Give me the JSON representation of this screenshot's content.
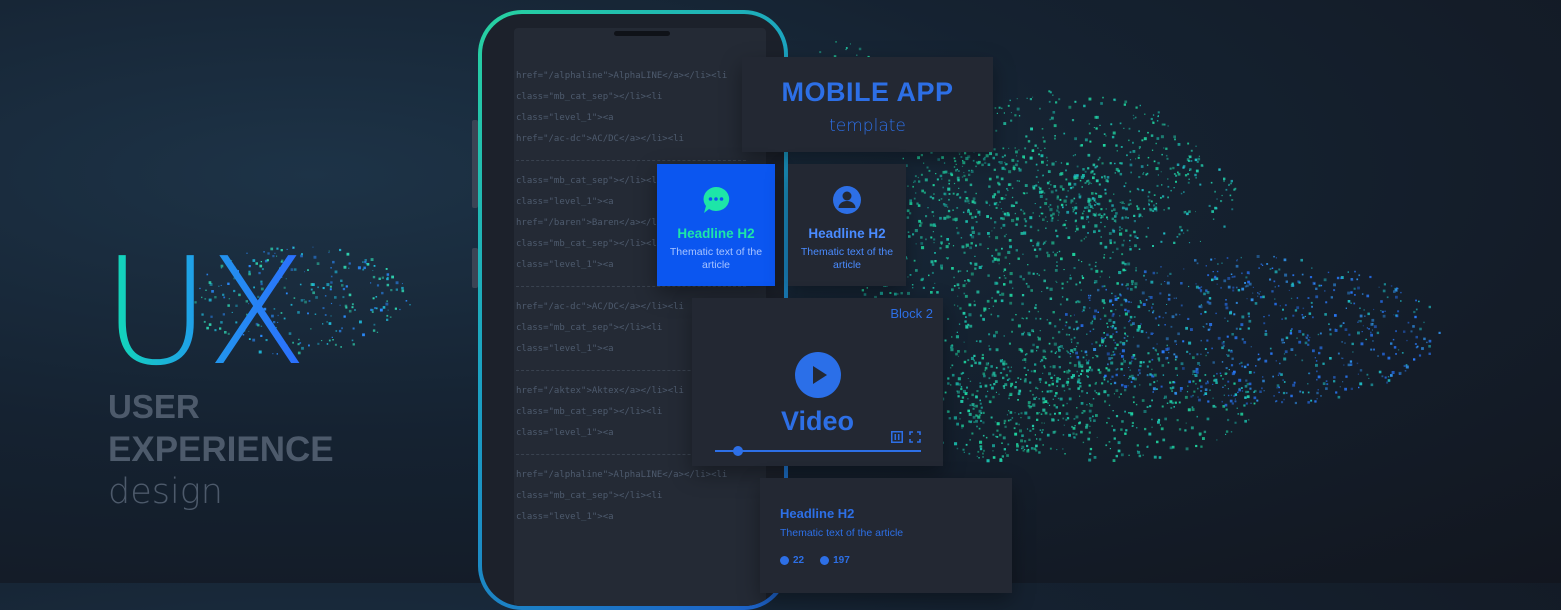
{
  "colors": {
    "accent_blue": "#2d6fe6",
    "bright_blue": "#0b56f0",
    "teal": "#1de6a8",
    "muted_text": "#4d5a6b",
    "card_bg": "#232833"
  },
  "hero": {
    "big_letters": "UX",
    "line1": "USER",
    "line2": "EXPERIENCE",
    "line3": "design"
  },
  "code_lines": [
    "href=\"/alphaline\">AlphaLINE</a></li><li",
    "class=\"mb_cat_sep\"></li><li",
    "class=\"level_1\"><a",
    "href=\"/ac-dc\">AC/DC</a></li><li",
    "",
    "class=\"mb_cat_sep\"></li><li",
    "class=\"level_1\"><a",
    "href=\"/baren\">Baren</a></li><li",
    "class=\"mb_cat_sep\"></li><li",
    "class=\"level_1\"><a",
    "",
    "href=\"/ac-dc\">AC/DC</a></li><li",
    "class=\"mb_cat_sep\"></li><li",
    "class=\"level_1\"><a",
    "",
    "href=\"/aktex\">Aktex</a></li><li",
    "class=\"mb_cat_sep\"></li><li",
    "class=\"level_1\"><a",
    "",
    "href=\"/alphaline\">AlphaLINE</a></li><li",
    "class=\"mb_cat_sep\"></li><li",
    "class=\"level_1\"><a"
  ],
  "mobile_card": {
    "title": "MOBILE APP",
    "subtitle": "template"
  },
  "card_chat": {
    "icon": "chat-bubble-icon",
    "title": "Headline H2",
    "text": "Thematic text of the article"
  },
  "card_user": {
    "icon": "user-icon",
    "title": "Headline H2",
    "text": "Thematic text of the article"
  },
  "video_card": {
    "block_label": "Block 2",
    "title": "Video",
    "progress": 0.11,
    "icons": [
      "play-icon",
      "pause-icon",
      "fullscreen-icon"
    ]
  },
  "article_card": {
    "title": "Headline H2",
    "text": "Thematic text of the article",
    "views": "22",
    "comments": "197"
  }
}
